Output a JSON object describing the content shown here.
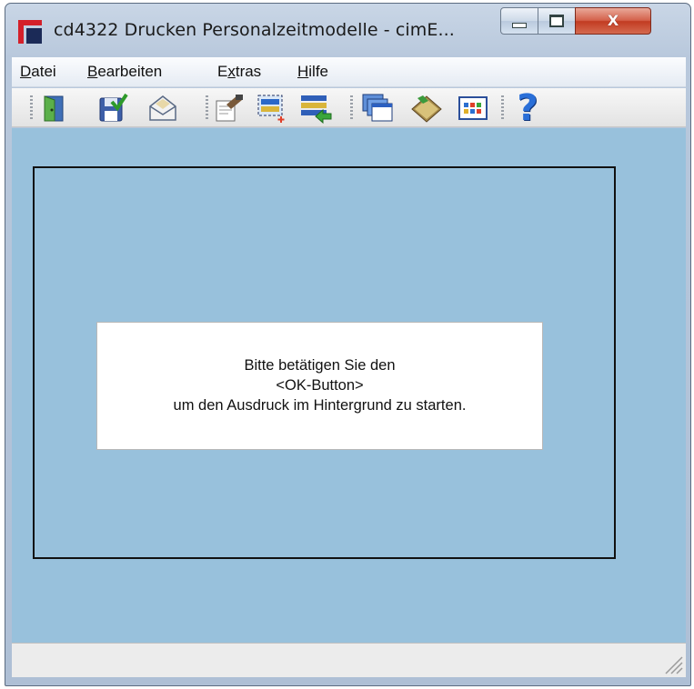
{
  "window": {
    "title": "cd4322 Drucken Personalzeitmodelle - cimE...",
    "close_glyph": "X"
  },
  "menu": [
    {
      "label": "Datei",
      "mnemonic": "D",
      "rest": "atei"
    },
    {
      "label": "Bearbeiten",
      "mnemonic": "B",
      "rest": "earbeiten"
    },
    {
      "label": "Extras",
      "mnemonic": "x",
      "prefix": "E",
      "rest": "tras"
    },
    {
      "label": "Hilfe",
      "mnemonic": "H",
      "rest": "ilfe"
    }
  ],
  "toolbar": {
    "icons": [
      "exit-door-icon",
      "save-check-icon",
      "envelope-icon",
      "page-setup-icon",
      "select-area-icon",
      "list-transfer-icon",
      "windows-icon",
      "book-icon",
      "calendar-grid-icon",
      "help-icon"
    ],
    "help_glyph": "?"
  },
  "message": {
    "line1": "Bitte betätigen Sie den",
    "line2": "<OK-Button>",
    "line3": "um den Ausdruck im Hintergrund zu starten."
  },
  "colors": {
    "client_background": "#98c1dc",
    "accent_red": "#d4202a"
  }
}
